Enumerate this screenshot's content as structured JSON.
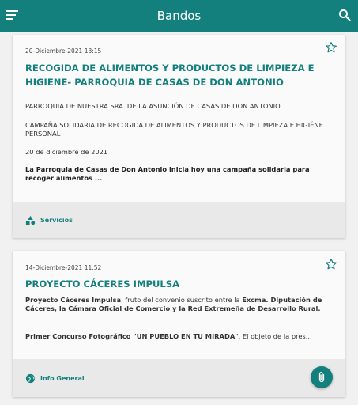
{
  "header": {
    "title": "Bandos",
    "menu_icon": "menu-icon",
    "search_icon": "search-icon",
    "color": "#13807d"
  },
  "cards": [
    {
      "date": "20-Diciembre-2021 13:15",
      "title": "RECOGIDA DE ALIMENTOS  Y PRODUCTOS DE LIMPIEZA E HIGIENE- PARROQUIA DE CASAS DE DON ANTONIO",
      "paragraph1": "PARROQUIA DE NUESTRA SRA. DE LA ASUNCIÓN DE CASAS DE DON ANTONIO",
      "paragraph2": "CAMPAÑA SOLIDARIA DE RECOGIDA DE ALIMENTOS Y PRODUCTOS DE LIMPIEZA E HIGIÉNE PERSONAL",
      "paragraph3": "20 de diciembre de 2021",
      "summary": "La Parroquia de Casas de Don Antonio inicia hoy una campaña solidaria para recoger alimentos ...",
      "category": "Servicios",
      "category_icon": "shapes-icon"
    },
    {
      "date": "14-Diciembre-2021 11:52",
      "title": "PROYECTO CÁCERES IMPULSA",
      "text1_bold_a": "Proyecto Cáceres Impulsa",
      "text1_normal_a": ", fruto del convenio suscrito entre la ",
      "text1_bold_b": "Excma. Diputación de Cáceres, la Cámara Oficial de Comercio y la Red Extremeña de Desarrollo Rural.",
      "text2_bold": "Primer Concurso Fotográfico \"UN PUEBLO EN TU MIRADA\"",
      "text2_normal": ". El objeto de la pres...",
      "category": "Info General",
      "category_icon": "globe-icon",
      "attachment_icon": "paperclip-icon"
    }
  ]
}
